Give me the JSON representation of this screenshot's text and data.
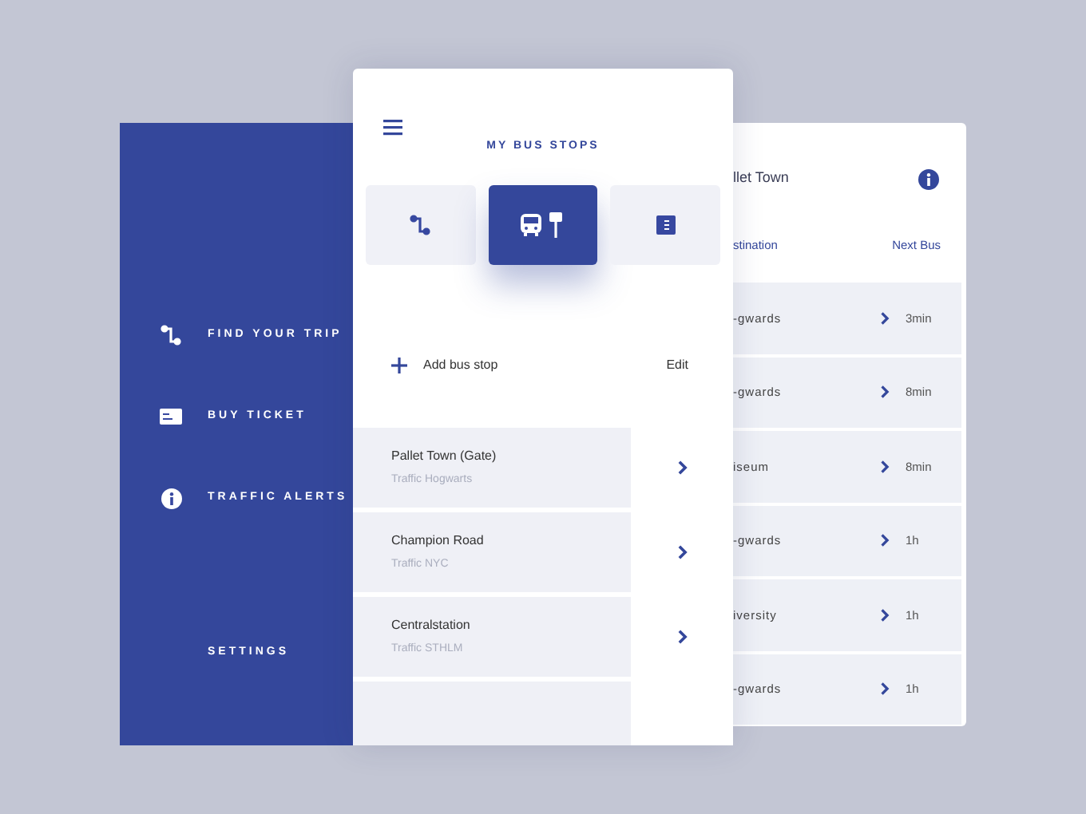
{
  "menu": {
    "items": [
      {
        "kind": "route",
        "label": "FIND YOUR TRIP"
      },
      {
        "kind": "ticket",
        "label": "BUY TICKET"
      },
      {
        "kind": "info",
        "label": "TRAFFIC ALERTS"
      }
    ],
    "settings": "SETTINGS"
  },
  "main": {
    "title": "MY BUS STOPS",
    "tabs": [
      {
        "kind": "route",
        "selected": false
      },
      {
        "kind": "bus",
        "selected": true
      },
      {
        "kind": "list",
        "selected": false
      }
    ],
    "add_label": "Add bus stop",
    "edit_label": "Edit",
    "stops": [
      {
        "name": "Pallet Town (Gate)",
        "sub": "Traffic Hogwarts"
      },
      {
        "name": "Champion Road",
        "sub": "Traffic NYC"
      },
      {
        "name": "Centralstation",
        "sub": "Traffic STHLM"
      }
    ]
  },
  "detail": {
    "title": "llet Town",
    "col_destination": "stination",
    "col_next": "Next Bus",
    "rows": [
      {
        "destination": "-gwards",
        "time": "3min"
      },
      {
        "destination": "-gwards",
        "time": "8min"
      },
      {
        "destination": "iseum",
        "time": "8min"
      },
      {
        "destination": "-gwards",
        "time": "1h"
      },
      {
        "destination": "iversity",
        "time": "1h"
      },
      {
        "destination": "-gwards",
        "time": "1h"
      }
    ]
  }
}
